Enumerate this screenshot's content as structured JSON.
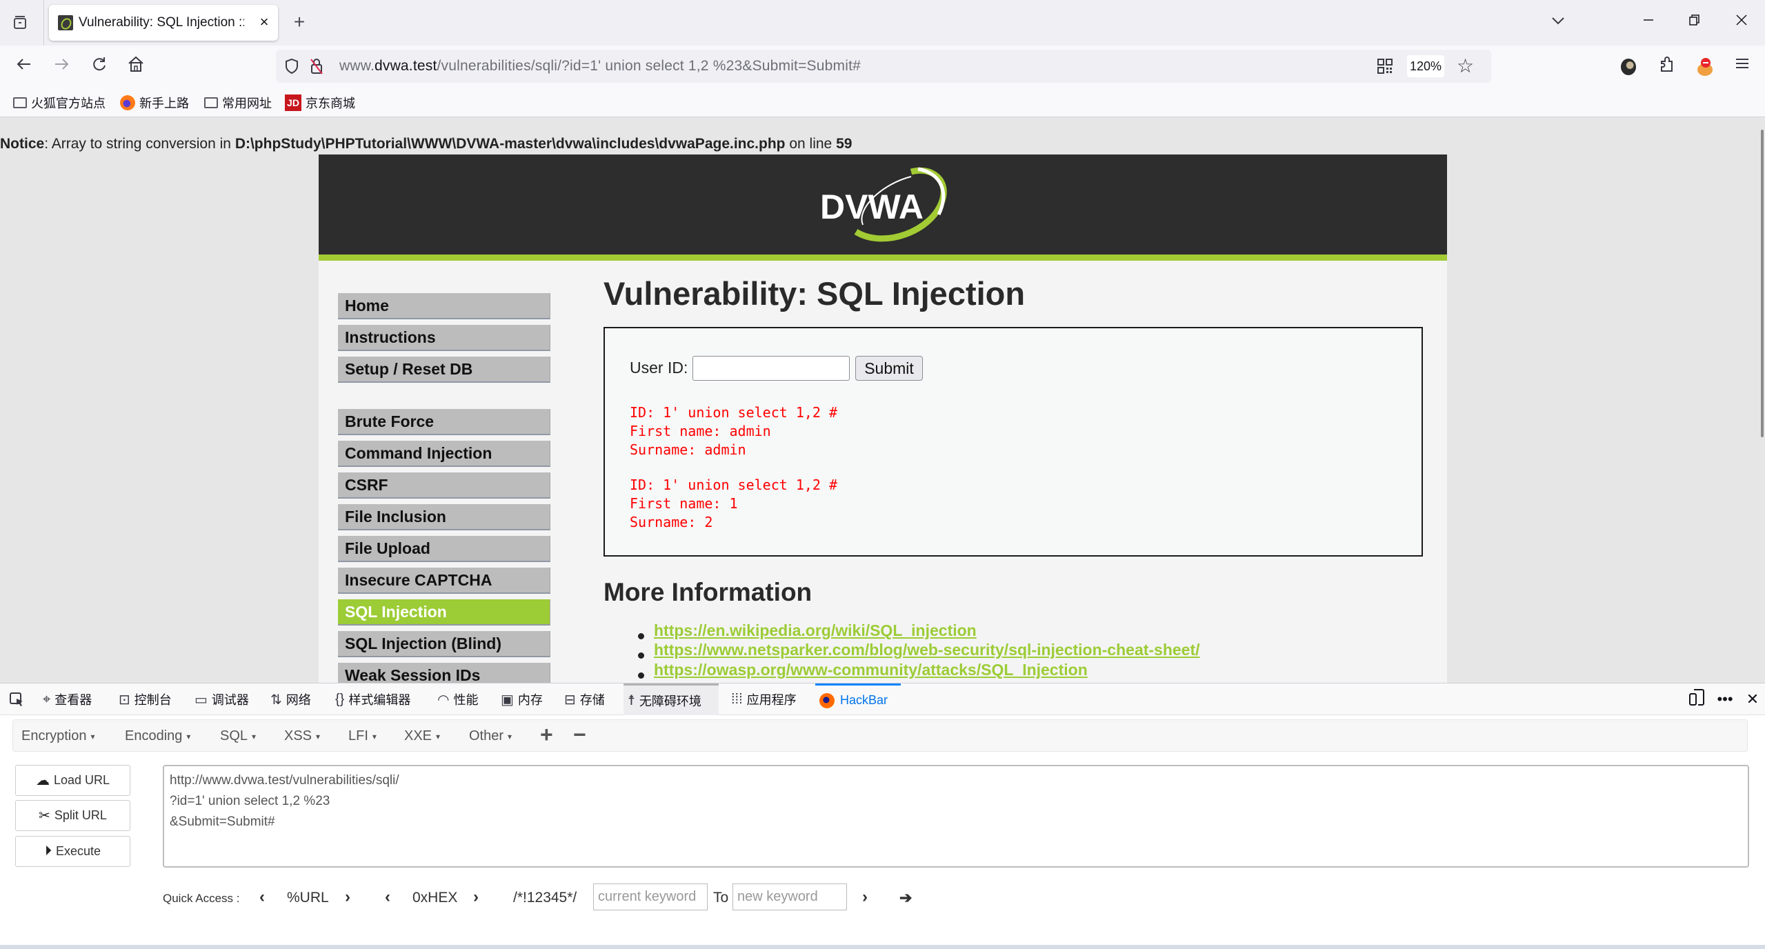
{
  "browser": {
    "tab_title": "Vulnerability: SQL Injection ::",
    "tab_close": "×",
    "new_tab": "+",
    "url_prefix": "www.",
    "url_domain": "dvwa.test",
    "url_rest": "/vulnerabilities/sqli/?id=1' union select 1,2 %23&Submit=Submit#",
    "zoom": "120%",
    "bookmarks": [
      {
        "label": "火狐官方站点",
        "icon": "folder-icon"
      },
      {
        "label": "新手上路",
        "icon": "firefox-icon"
      },
      {
        "label": "常用网址",
        "icon": "folder-icon"
      },
      {
        "label": "京东商城",
        "icon": "jd-icon"
      }
    ],
    "jd_badge": "JD"
  },
  "notice": {
    "label": "Notice",
    "text1": ": Array to string conversion in ",
    "path": "D:\\phpStudy\\PHPTutorial\\WWW\\DVWA-master\\dvwa\\includes\\dvwaPage.inc.php",
    "text2": " on line ",
    "line": "59"
  },
  "dvwa": {
    "logo_text": "DVWA",
    "menu_group1": [
      "Home",
      "Instructions",
      "Setup / Reset DB"
    ],
    "menu_group2": [
      "Brute Force",
      "Command Injection",
      "CSRF",
      "File Inclusion",
      "File Upload",
      "Insecure CAPTCHA",
      "SQL Injection",
      "SQL Injection (Blind)",
      "Weak Session IDs"
    ],
    "active_menu": "SQL Injection",
    "title": "Vulnerability: SQL Injection",
    "form": {
      "label": "User ID:",
      "value": "",
      "submit": "Submit"
    },
    "results": [
      {
        "id": "ID: 1' union select 1,2 #",
        "first": "First name: admin",
        "surname": "Surname: admin"
      },
      {
        "id": "ID: 1' union select 1,2 #",
        "first": "First name: 1",
        "surname": "Surname: 2"
      }
    ],
    "more_info_title": "More Information",
    "links": [
      "https://en.wikipedia.org/wiki/SQL_injection",
      "https://www.netsparker.com/blog/web-security/sql-injection-cheat-sheet/",
      "https://owasp.org/www-community/attacks/SQL_Injection"
    ],
    "colors": {
      "accent_green": "#9ccc36",
      "header_dark": "#2d2d2d",
      "result_red": "#ff0000"
    }
  },
  "devtools": {
    "tabs": [
      {
        "label": "查看器",
        "icon": "inspector-icon"
      },
      {
        "label": "控制台",
        "icon": "console-icon"
      },
      {
        "label": "调试器",
        "icon": "debugger-icon"
      },
      {
        "label": "网络",
        "icon": "network-icon"
      },
      {
        "label": "样式编辑器",
        "icon": "style-editor-icon"
      },
      {
        "label": "性能",
        "icon": "performance-icon"
      },
      {
        "label": "内存",
        "icon": "memory-icon"
      },
      {
        "label": "存储",
        "icon": "storage-icon"
      },
      {
        "label": "无障碍环境",
        "icon": "accessibility-icon"
      },
      {
        "label": "应用程序",
        "icon": "application-icon"
      },
      {
        "label": "HackBar",
        "icon": "hackbar-icon"
      }
    ],
    "selected_tab": "HackBar"
  },
  "hackbar": {
    "menus": [
      "Encryption",
      "Encoding",
      "SQL",
      "XSS",
      "LFI",
      "XXE",
      "Other"
    ],
    "buttons": {
      "load": "Load URL",
      "split": "Split URL",
      "execute": "Execute"
    },
    "url_text": "http://www.dvwa.test/vulnerabilities/sqli/\n?id=1' union select 1,2 %23\n&Submit=Submit#",
    "quick_access_label": "Quick Access :",
    "quick_url": "%URL",
    "quick_hex": "0xHEX",
    "quick_comment": "/*!12345*/",
    "current_keyword_placeholder": "current keyword",
    "to_label": "To",
    "new_keyword_placeholder": "new keyword"
  }
}
